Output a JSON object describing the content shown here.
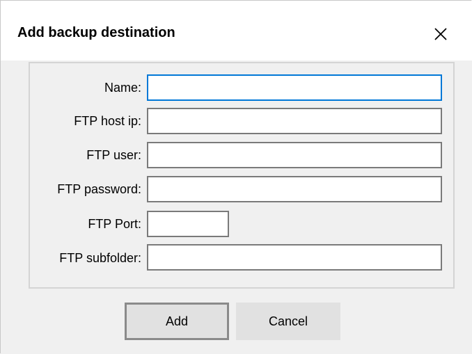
{
  "dialog": {
    "title": "Add backup destination",
    "close_icon": "close-icon"
  },
  "form": {
    "fields": [
      {
        "label": "Name:",
        "value": "",
        "placeholder": ""
      },
      {
        "label": "FTP host ip:",
        "value": "",
        "placeholder": ""
      },
      {
        "label": "FTP user:",
        "value": "",
        "placeholder": ""
      },
      {
        "label": "FTP password:",
        "value": "",
        "placeholder": ""
      },
      {
        "label": "FTP Port:",
        "value": "",
        "placeholder": ""
      },
      {
        "label": "FTP subfolder:",
        "value": "",
        "placeholder": ""
      }
    ]
  },
  "buttons": {
    "add_label": "Add",
    "cancel_label": "Cancel"
  },
  "colors": {
    "focus_border": "#0078d7",
    "field_border": "#7a7a7a",
    "background": "#f0f0f0"
  }
}
